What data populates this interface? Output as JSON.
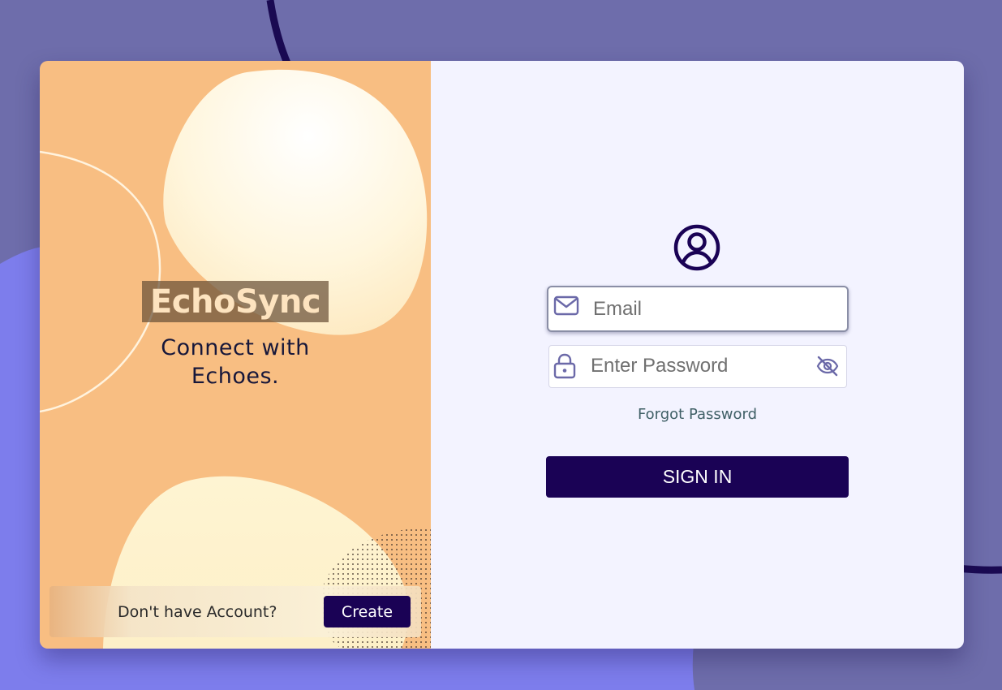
{
  "brand": {
    "name": "EchoSync",
    "tagline": "Connect with Echoes."
  },
  "signup": {
    "prompt": "Don't have Account?",
    "button_label": "Create"
  },
  "login": {
    "email_placeholder": "Email",
    "email_value": "",
    "password_placeholder": "Enter Password",
    "password_value": "",
    "forgot_label": "Forgot Password",
    "signin_label": "SIGN IN"
  },
  "icons": {
    "avatar": "user-circle-icon",
    "email": "envelope-icon",
    "password": "lock-icon",
    "visibility": "eye-slash-icon"
  },
  "colors": {
    "background": "#6e6dab",
    "left_panel": "#f8be82",
    "right_panel": "#f3f3ff",
    "accent": "#1a0255",
    "input_icon": "#6b69a8",
    "link": "#3f5f66"
  }
}
